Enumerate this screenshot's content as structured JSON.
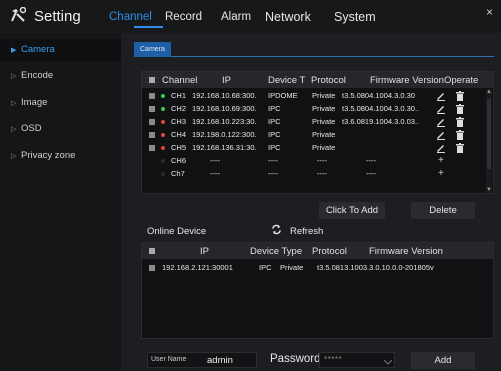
{
  "app": {
    "title": "Setting"
  },
  "tabs": [
    {
      "label": "Channel",
      "active": true
    },
    {
      "label": "Record"
    },
    {
      "label": "Alarm"
    },
    {
      "label": "Network"
    },
    {
      "label": "System"
    }
  ],
  "close_label": "×",
  "sidebar": {
    "items": [
      {
        "label": "Camera",
        "active": true
      },
      {
        "label": "Encode"
      },
      {
        "label": "Image"
      },
      {
        "label": "OSD"
      },
      {
        "label": "Privacy zone"
      }
    ]
  },
  "subtab": {
    "label": "Camera"
  },
  "channel_table": {
    "headers": [
      "Channel",
      "IP",
      "Device T",
      "Protocol",
      "Firmware Version",
      "Operate"
    ],
    "rows": [
      {
        "status": "#39c65a",
        "channel": "CH1",
        "ip": "192.168.10.68:300.",
        "type": "IPDOME",
        "protocol": "Private",
        "firmware": "t3.5.0804.1004.3.0.30"
      },
      {
        "status": "#39c65a",
        "channel": "CH2",
        "ip": "192.168.10.69:300.",
        "type": "IPC",
        "protocol": "Private",
        "firmware": "t3.5.0804.1004.3.0.30.."
      },
      {
        "status": "#e0443a",
        "channel": "CH3",
        "ip": "192.168.10.223:30.",
        "type": "IPC",
        "protocol": "Private",
        "firmware": "t3.6.0819.1004.3.0.03.."
      },
      {
        "status": "#e0443a",
        "channel": "CH4",
        "ip": "192.198.0.122:300.",
        "type": "IPC",
        "protocol": "Private",
        "firmware": ""
      },
      {
        "status": "#e0443a",
        "channel": "CH5",
        "ip": "192.168.136.31:30.",
        "type": "IPC",
        "protocol": "Private",
        "firmware": ""
      },
      {
        "status": "#2a2b2d",
        "channel": "CH6",
        "ip": "----",
        "type": "----",
        "protocol": "----",
        "firmware": "----"
      },
      {
        "status": "#2a2b2d",
        "channel": "Ch7",
        "ip": "----",
        "type": "----",
        "protocol": "----",
        "firmware": "----"
      }
    ]
  },
  "buttons": {
    "click_to_add": "Click To Add",
    "delete": "Delete",
    "refresh": "Refresh",
    "add": "Add"
  },
  "online": {
    "label": "Online Device",
    "headers": [
      "IP",
      "Device Type",
      "Protocol",
      "Firmware Version"
    ],
    "rows": [
      {
        "ip": "192.168.2.121:30001",
        "type": "IPC",
        "protocol": "Private",
        "firmware": "t3.5.0813.1003.3.0.10.0.0-201805v"
      }
    ]
  },
  "footer": {
    "username_label": "User Name",
    "username_value": "admin",
    "password_label": "Password",
    "password_value": "*****"
  }
}
